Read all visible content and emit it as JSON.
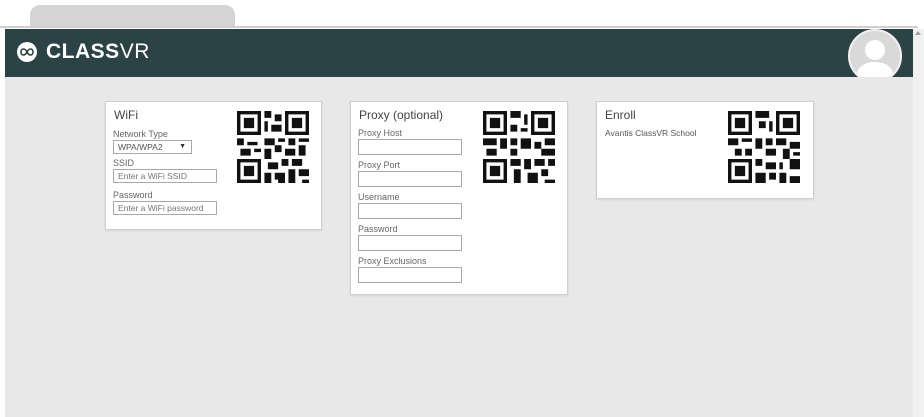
{
  "app": {
    "brand_bold": "CLASS",
    "brand_light": "VR"
  },
  "cards": {
    "wifi": {
      "title": "WiFi",
      "network_type_label": "Network Type",
      "network_type_value": "WPA/WPA2",
      "ssid_label": "SSID",
      "ssid_placeholder": "Enter a WiFi SSID",
      "password_label": "Password",
      "password_placeholder": "Enter a WiFi password"
    },
    "proxy": {
      "title": "Proxy (optional)",
      "host_label": "Proxy Host",
      "port_label": "Proxy Port",
      "username_label": "Username",
      "password_label": "Password",
      "exclusions_label": "Proxy Exclusions"
    },
    "enroll": {
      "title": "Enroll",
      "school_name": "Avantis ClassVR School"
    }
  },
  "icons": {
    "logo": "infinity-icon",
    "avatar": "user-avatar-icon",
    "qr": "qr-code-icon"
  },
  "colors": {
    "header": "#2b4345",
    "background": "#e8e8e8",
    "card": "#ffffff"
  }
}
